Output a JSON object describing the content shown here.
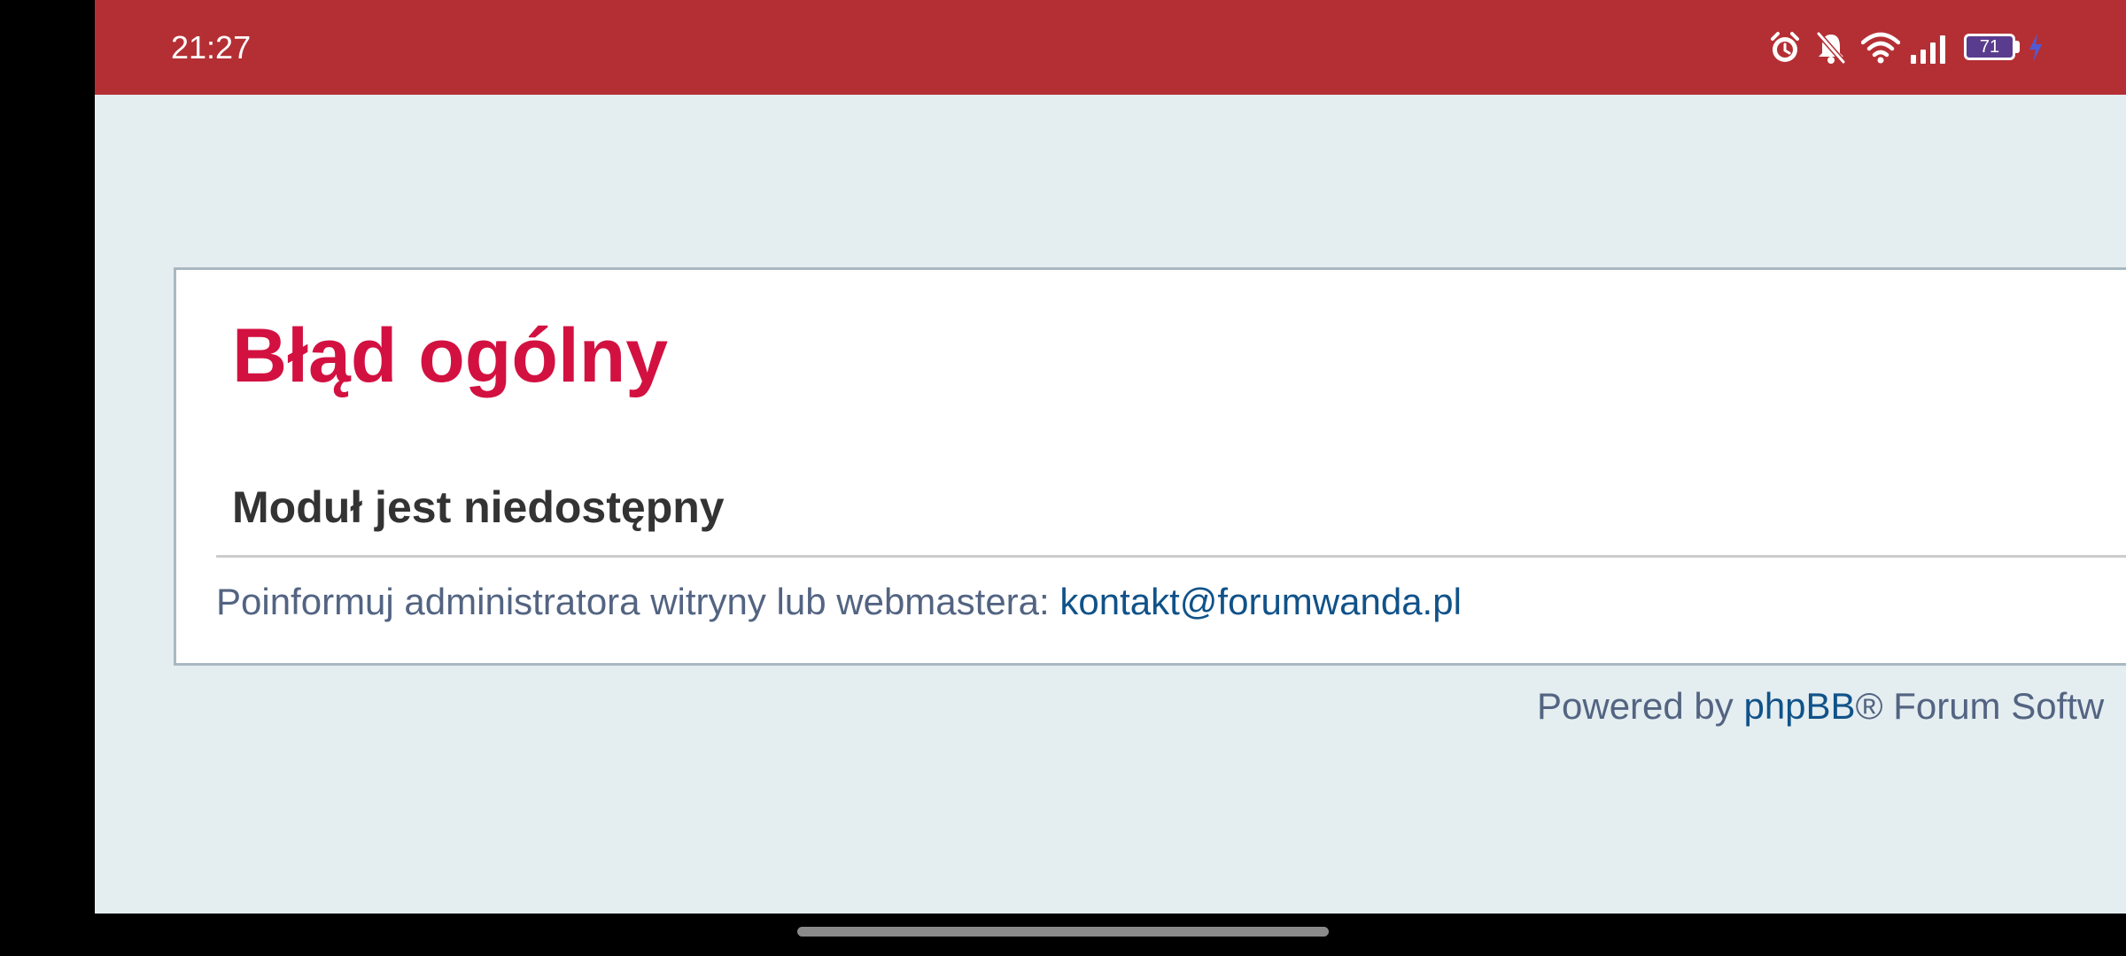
{
  "status_bar": {
    "time": "21:27",
    "battery_level": "71",
    "icons": [
      "alarm-icon",
      "bell-muted-icon",
      "wifi-icon",
      "signal-icon",
      "battery-icon",
      "charging-icon"
    ],
    "background_color": "#b42f34"
  },
  "page": {
    "title": "Błąd ogólny",
    "error_heading": "Moduł jest niedostępny",
    "message_prefix": "Poinformuj administratora witryny lub webmastera: ",
    "contact_email": "kontakt@forumwanda.pl",
    "title_color": "#d31141",
    "background_color": "#e4edf0"
  },
  "footer": {
    "prefix": "Powered by ",
    "brand_link": "phpBB",
    "suffix": "® Forum Softw"
  }
}
